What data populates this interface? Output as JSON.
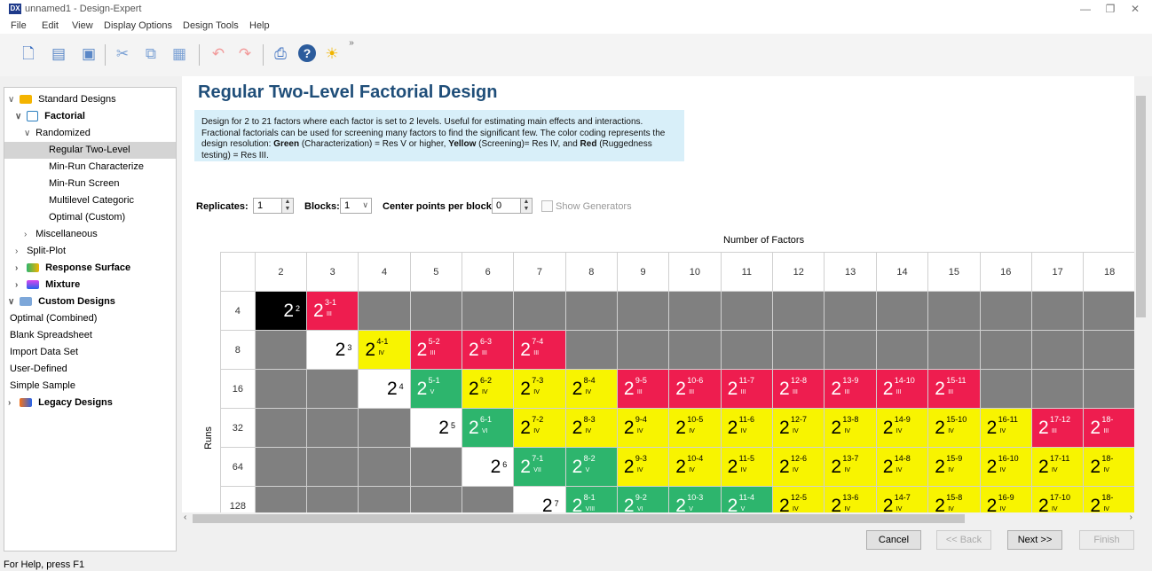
{
  "window": {
    "title": "unnamed1 - Design-Expert",
    "icon": "DX"
  },
  "menu": [
    "File",
    "Edit",
    "View",
    "Display Options",
    "Design Tools",
    "Help"
  ],
  "toolbar": {
    "overflow": "»"
  },
  "tree": {
    "items": [
      {
        "label": "Standard Designs",
        "chev": "∨",
        "icon": "folder-icon",
        "bold": false
      },
      {
        "label": "Factorial",
        "chev": "∨",
        "icon": "cube-icon",
        "bold": true
      },
      {
        "label": "Randomized",
        "chev": "∨",
        "bold": false
      },
      {
        "label": "Regular Two-Level",
        "selected": true
      },
      {
        "label": "Min-Run Characterize"
      },
      {
        "label": "Min-Run Screen"
      },
      {
        "label": "Multilevel Categoric"
      },
      {
        "label": "Optimal (Custom)"
      },
      {
        "label": "Miscellaneous",
        "chev": ">"
      },
      {
        "label": "Split-Plot",
        "chev": ">"
      },
      {
        "label": "Response Surface",
        "chev": ">",
        "icon": "surface-icon",
        "bold": true
      },
      {
        "label": "Mixture",
        "chev": ">",
        "icon": "flask-icon",
        "bold": true
      },
      {
        "label": "Custom Designs",
        "chev": "∨",
        "icon": "custom-icon",
        "bold": true
      },
      {
        "label": "Optimal (Combined)"
      },
      {
        "label": "Blank Spreadsheet"
      },
      {
        "label": "Import Data Set"
      },
      {
        "label": "User-Defined"
      },
      {
        "label": "Simple Sample"
      },
      {
        "label": "Legacy Designs",
        "chev": ">",
        "icon": "legacy-icon",
        "bold": true
      }
    ]
  },
  "main": {
    "heading": "Regular Two-Level Factorial Design",
    "desc_part1": "Design for 2 to 21 factors where each factor is set to 2 levels. Useful for estimating main effects and interactions. Fractional factorials can be used for screening many factors to find the significant few. The color coding represents the design resolution: ",
    "desc_green": "Green",
    "desc_part2": " (Characterization) = Res V or higher, ",
    "desc_yellow": "Yellow",
    "desc_part3": " (Screening)= Res IV, and ",
    "desc_red": "Red",
    "desc_part4": " (Ruggedness testing) = Res III.",
    "replicates_label": "Replicates:",
    "replicates_value": "1",
    "blocks_label": "Blocks:",
    "blocks_value": "1",
    "center_label": "Center points per block:",
    "center_value": "0",
    "show_generators": "Show Generators",
    "num_factors_label": "Number of Factors",
    "runs_label": "Runs"
  },
  "grid": {
    "factors": [
      "2",
      "3",
      "4",
      "5",
      "6",
      "7",
      "8",
      "9",
      "10",
      "11",
      "12",
      "13",
      "14",
      "15",
      "16",
      "17",
      "18"
    ],
    "rows": [
      {
        "runs": "4",
        "cells": [
          {
            "c": "black",
            "e": "2",
            "full": true
          },
          {
            "c": "red",
            "e": "3-1",
            "r": "III"
          },
          {},
          {},
          {},
          {},
          {},
          {},
          {},
          {},
          {},
          {},
          {},
          {},
          {},
          {},
          {}
        ]
      },
      {
        "runs": "8",
        "cells": [
          {},
          {
            "c": "white",
            "e": "3",
            "full": true
          },
          {
            "c": "yellow",
            "e": "4-1",
            "r": "IV"
          },
          {
            "c": "red",
            "e": "5-2",
            "r": "III"
          },
          {
            "c": "red",
            "e": "6-3",
            "r": "III"
          },
          {
            "c": "red",
            "e": "7-4",
            "r": "III"
          },
          {},
          {},
          {},
          {},
          {},
          {},
          {},
          {},
          {},
          {},
          {}
        ]
      },
      {
        "runs": "16",
        "cells": [
          {},
          {},
          {
            "c": "white",
            "e": "4",
            "full": true
          },
          {
            "c": "green",
            "e": "5-1",
            "r": "V"
          },
          {
            "c": "yellow",
            "e": "6-2",
            "r": "IV"
          },
          {
            "c": "yellow",
            "e": "7-3",
            "r": "IV"
          },
          {
            "c": "yellow",
            "e": "8-4",
            "r": "IV"
          },
          {
            "c": "red",
            "e": "9-5",
            "r": "III"
          },
          {
            "c": "red",
            "e": "10-6",
            "r": "III"
          },
          {
            "c": "red",
            "e": "11-7",
            "r": "III"
          },
          {
            "c": "red",
            "e": "12-8",
            "r": "III"
          },
          {
            "c": "red",
            "e": "13-9",
            "r": "III"
          },
          {
            "c": "red",
            "e": "14-10",
            "r": "III"
          },
          {
            "c": "red",
            "e": "15-11",
            "r": "III"
          },
          {},
          {},
          {}
        ]
      },
      {
        "runs": "32",
        "cells": [
          {},
          {},
          {},
          {
            "c": "white",
            "e": "5",
            "full": true
          },
          {
            "c": "green",
            "e": "6-1",
            "r": "VI"
          },
          {
            "c": "yellow",
            "e": "7-2",
            "r": "IV"
          },
          {
            "c": "yellow",
            "e": "8-3",
            "r": "IV"
          },
          {
            "c": "yellow",
            "e": "9-4",
            "r": "IV"
          },
          {
            "c": "yellow",
            "e": "10-5",
            "r": "IV"
          },
          {
            "c": "yellow",
            "e": "11-6",
            "r": "IV"
          },
          {
            "c": "yellow",
            "e": "12-7",
            "r": "IV"
          },
          {
            "c": "yellow",
            "e": "13-8",
            "r": "IV"
          },
          {
            "c": "yellow",
            "e": "14-9",
            "r": "IV"
          },
          {
            "c": "yellow",
            "e": "15-10",
            "r": "IV"
          },
          {
            "c": "yellow",
            "e": "16-11",
            "r": "IV"
          },
          {
            "c": "red",
            "e": "17-12",
            "r": "III"
          },
          {
            "c": "red",
            "e": "18-",
            "r": "III"
          }
        ]
      },
      {
        "runs": "64",
        "cells": [
          {},
          {},
          {},
          {},
          {
            "c": "white",
            "e": "6",
            "full": true
          },
          {
            "c": "green",
            "e": "7-1",
            "r": "VII"
          },
          {
            "c": "green",
            "e": "8-2",
            "r": "V"
          },
          {
            "c": "yellow",
            "e": "9-3",
            "r": "IV"
          },
          {
            "c": "yellow",
            "e": "10-4",
            "r": "IV"
          },
          {
            "c": "yellow",
            "e": "11-5",
            "r": "IV"
          },
          {
            "c": "yellow",
            "e": "12-6",
            "r": "IV"
          },
          {
            "c": "yellow",
            "e": "13-7",
            "r": "IV"
          },
          {
            "c": "yellow",
            "e": "14-8",
            "r": "IV"
          },
          {
            "c": "yellow",
            "e": "15-9",
            "r": "IV"
          },
          {
            "c": "yellow",
            "e": "16-10",
            "r": "IV"
          },
          {
            "c": "yellow",
            "e": "17-11",
            "r": "IV"
          },
          {
            "c": "yellow",
            "e": "18-",
            "r": "IV"
          }
        ]
      },
      {
        "runs": "128",
        "cells": [
          {},
          {},
          {},
          {},
          {},
          {
            "c": "white",
            "e": "7",
            "full": true
          },
          {
            "c": "green",
            "e": "8-1",
            "r": "VIII"
          },
          {
            "c": "green",
            "e": "9-2",
            "r": "VI"
          },
          {
            "c": "green",
            "e": "10-3",
            "r": "V"
          },
          {
            "c": "green",
            "e": "11-4",
            "r": "V"
          },
          {
            "c": "yellow",
            "e": "12-5",
            "r": "IV"
          },
          {
            "c": "yellow",
            "e": "13-6",
            "r": "IV"
          },
          {
            "c": "yellow",
            "e": "14-7",
            "r": "IV"
          },
          {
            "c": "yellow",
            "e": "15-8",
            "r": "IV"
          },
          {
            "c": "yellow",
            "e": "16-9",
            "r": "IV"
          },
          {
            "c": "yellow",
            "e": "17-10",
            "r": "IV"
          },
          {
            "c": "yellow",
            "e": "18-",
            "r": "IV"
          }
        ]
      }
    ]
  },
  "buttons": {
    "cancel": "Cancel",
    "back": "<< Back",
    "next": "Next >>",
    "finish": "Finish"
  },
  "status": "For Help, press F1"
}
